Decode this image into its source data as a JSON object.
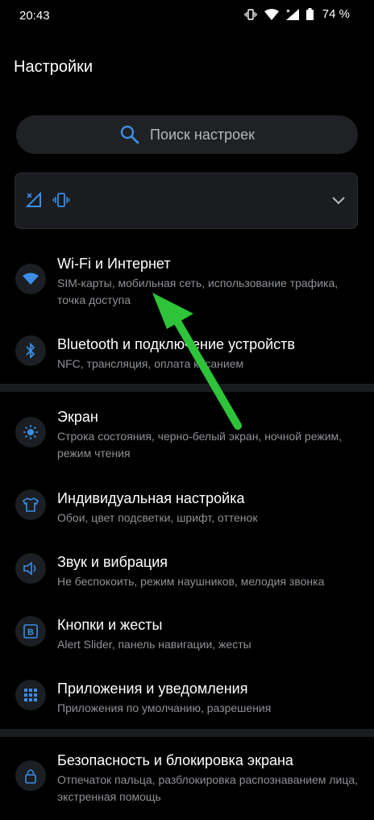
{
  "status_bar": {
    "time": "20:43",
    "battery": "74 %"
  },
  "header": {
    "title": "Настройки"
  },
  "search": {
    "placeholder": "Поиск настроек"
  },
  "colors": {
    "accent": "#3a8ee6",
    "background": "#000000",
    "card": "#1f2124",
    "subtitle": "#8e9196",
    "arrow": "#2ec43a"
  },
  "quick_settings": {
    "icons": [
      "no-sim-icon",
      "vibrate-icon"
    ],
    "expand_icon": "chevron-down-icon"
  },
  "settings": [
    {
      "title": "Wi-Fi и Интернет",
      "subtitle": "SIM-карты, мобильная сеть, использование трафика, точка доступа",
      "icon": "wifi-icon"
    },
    {
      "title": "Bluetooth и подключение устройств",
      "subtitle": "NFC, трансляция, оплата касанием",
      "icon": "bluetooth-icon"
    },
    {
      "title": "Экран",
      "subtitle": "Строка состояния, черно-белый экран, ночной режим, режим чтения",
      "icon": "brightness-icon"
    },
    {
      "title": "Индивидуальная настройка",
      "subtitle": "Обои, цвет подсветки, шрифт, оттенок",
      "icon": "tshirt-icon"
    },
    {
      "title": "Звук и вибрация",
      "subtitle": "Не беспокоить, режим наушников, мелодия звонка",
      "icon": "speaker-icon"
    },
    {
      "title": "Кнопки и жесты",
      "subtitle": "Alert Slider, панель навигации, жесты",
      "icon": "buttons-icon"
    },
    {
      "title": "Приложения и уведомления",
      "subtitle": "Приложения по умолчанию, разрешения",
      "icon": "apps-grid-icon"
    },
    {
      "title": "Безопасность и блокировка экрана",
      "subtitle": "Отпечаток пальца, разблокировка распознаванием лица, экстренная помощь",
      "icon": "lock-icon"
    }
  ]
}
